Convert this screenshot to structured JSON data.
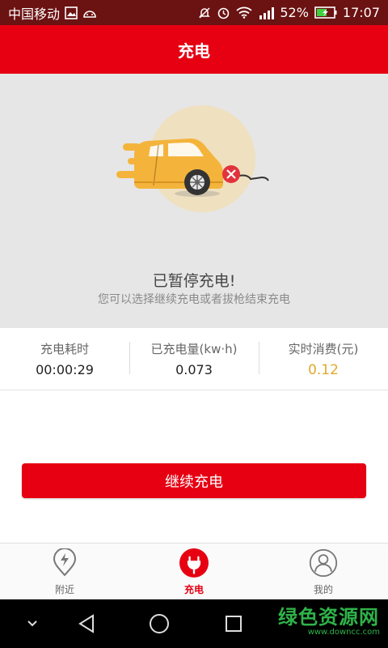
{
  "status_bar": {
    "carrier": "中国移动",
    "battery_percent": "52%",
    "time": "17:07",
    "icons": [
      "gallery-icon",
      "android-icon",
      "mute-icon",
      "alarm-icon",
      "wifi-icon",
      "signal-icon",
      "battery-icon"
    ]
  },
  "header": {
    "title": "充电"
  },
  "hero": {
    "title": "已暂停充电!",
    "subtitle": "您可以选择继续充电或者拔枪结束充电",
    "colors": {
      "car": "#f4b43c",
      "circle": "#efe0c0",
      "error": "#e2333c"
    }
  },
  "stats": [
    {
      "label": "充电耗时",
      "value": "00:00:29"
    },
    {
      "label": "已充电量(kw·h)",
      "value": "0.073"
    },
    {
      "label": "实时消费(元)",
      "value": "0.12"
    }
  ],
  "actions": {
    "continue_label": "继续充电"
  },
  "tabs": [
    {
      "label": "附近",
      "icon": "location-bolt-icon",
      "active": false
    },
    {
      "label": "充电",
      "icon": "plug-icon",
      "active": true
    },
    {
      "label": "我的",
      "icon": "user-icon",
      "active": false
    }
  ],
  "watermark": {
    "main": "绿色资源网",
    "sub": "www.downcc.com"
  },
  "colors": {
    "brand": "#e60012",
    "accent": "#e0a82e"
  }
}
